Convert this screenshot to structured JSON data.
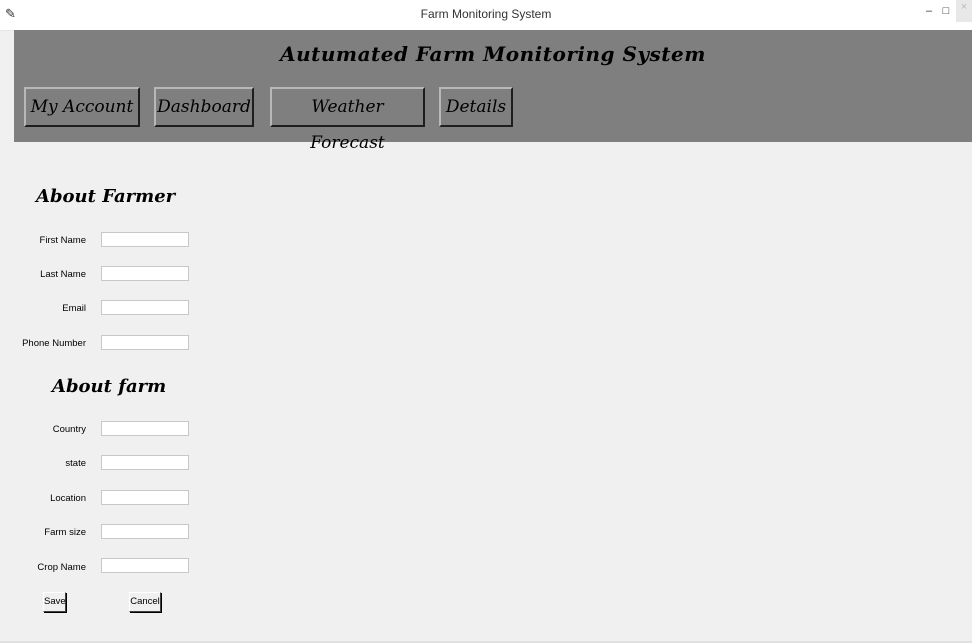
{
  "window": {
    "title": "Farm Monitoring System",
    "app_icon": "feather-icon",
    "controls": {
      "minimize": "–",
      "maximize": "□",
      "close": "×"
    }
  },
  "header": {
    "title": "Autumated Farm Monitoring System",
    "nav": [
      {
        "label": "My Account"
      },
      {
        "label": "Dashboard"
      },
      {
        "label": "Weather Forecast"
      },
      {
        "label": "Details"
      }
    ]
  },
  "farmer": {
    "title": "About Farmer",
    "fields": [
      {
        "label": "First Name",
        "value": ""
      },
      {
        "label": "Last Name",
        "value": ""
      },
      {
        "label": "Email",
        "value": ""
      },
      {
        "label": "Phone Number",
        "value": ""
      }
    ]
  },
  "farm": {
    "title": "About farm",
    "fields": [
      {
        "label": "Country",
        "value": ""
      },
      {
        "label": "state",
        "value": ""
      },
      {
        "label": "Location",
        "value": ""
      },
      {
        "label": "Farm size",
        "value": ""
      },
      {
        "label": "Crop Name",
        "value": ""
      }
    ]
  },
  "actions": {
    "save": "Save",
    "cancel": "Cancel"
  },
  "colors": {
    "header_bg": "#7f7f7f",
    "window_bg": "#f0f0f0",
    "input_bg": "#ffffff"
  }
}
